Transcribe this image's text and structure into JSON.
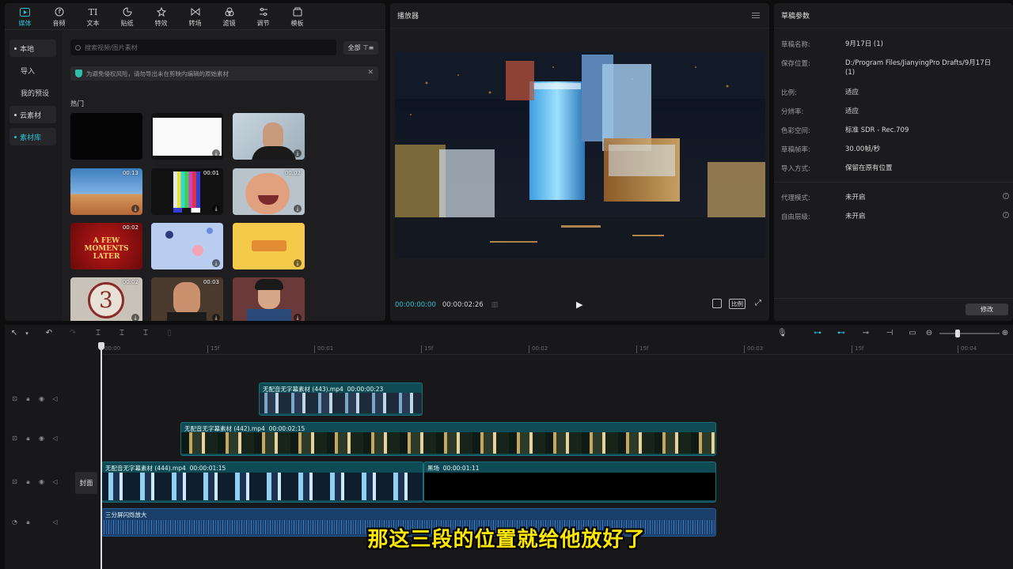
{
  "media_panel": {
    "tabs": [
      {
        "label": "媒体",
        "icon": "media-icon",
        "active": true
      },
      {
        "label": "音频",
        "icon": "audio-icon"
      },
      {
        "label": "文本",
        "icon": "text-icon"
      },
      {
        "label": "贴纸",
        "icon": "sticker-icon"
      },
      {
        "label": "特效",
        "icon": "effects-icon"
      },
      {
        "label": "转场",
        "icon": "transition-icon"
      },
      {
        "label": "滤镜",
        "icon": "filter-icon"
      },
      {
        "label": "调节",
        "icon": "adjust-icon"
      },
      {
        "label": "模板",
        "icon": "template-icon"
      }
    ],
    "sidebar": [
      "本地",
      "导入",
      "我的预设",
      "云素材",
      "素材库"
    ],
    "search_placeholder": "搜索视频/图片素材",
    "filter_label": "全部",
    "notice": "为避免侵权风险，请勿导出未在剪映内编辑的原始素材",
    "section": "热门",
    "thumbs": [
      {
        "duration": "",
        "caption": ""
      },
      {
        "duration": "",
        "caption": ""
      },
      {
        "duration": "",
        "caption": ""
      },
      {
        "duration": "00:13",
        "caption": ""
      },
      {
        "duration": "00:01",
        "caption": ""
      },
      {
        "duration": "00:02",
        "caption": ""
      },
      {
        "duration": "00:02",
        "caption": "A FEW MOMENTS LATER"
      },
      {
        "duration": "",
        "caption": ""
      },
      {
        "duration": "",
        "caption": ""
      },
      {
        "duration": "00:02",
        "caption": ""
      },
      {
        "duration": "00:03",
        "caption": ""
      },
      {
        "duration": "",
        "caption": ""
      }
    ]
  },
  "player": {
    "title": "播放器",
    "current_time": "00:00:00:00",
    "total_time": "00:00:02:26",
    "ratio_label": "比例"
  },
  "props": {
    "title": "草稿参数",
    "rows": [
      {
        "key": "草稿名称:",
        "value": "9月17日 (1)"
      },
      {
        "key": "保存位置:",
        "value": "D:/Program Files/JianyingPro Drafts/9月17日 (1)"
      },
      {
        "key": "比例:",
        "value": "适应"
      },
      {
        "key": "分辨率:",
        "value": "适应"
      },
      {
        "key": "色彩空间:",
        "value": "标准 SDR - Rec.709"
      },
      {
        "key": "草稿帧率:",
        "value": "30.00帧/秒"
      },
      {
        "key": "导入方式:",
        "value": "保留在原有位置"
      },
      {
        "key": "代理模式:",
        "value": "未开启"
      },
      {
        "key": "自由层级:",
        "value": "未开启"
      }
    ],
    "modify_label": "修改"
  },
  "timeline": {
    "ruler": [
      {
        "label": "00:00"
      },
      {
        "label": "15f"
      },
      {
        "label": "00:01"
      },
      {
        "label": "15f"
      },
      {
        "label": "00:02"
      },
      {
        "label": "15f"
      },
      {
        "label": "00:03"
      },
      {
        "label": "15f"
      },
      {
        "label": "00:04"
      }
    ],
    "cover_label": "封面",
    "clips": {
      "c443": {
        "name": "无配音无字幕素材 (443).mp4",
        "duration": "00:00:00:23"
      },
      "c442": {
        "name": "无配音无字幕素材 (442).mp4",
        "duration": "00:00:02:15"
      },
      "c444": {
        "name": "无配音无字幕素材 (444).mp4",
        "duration": "00:00:01:15"
      },
      "black": {
        "name": "黑场",
        "duration": "00:00:01:11"
      },
      "audio": {
        "name": "三分屏闪烁放大"
      }
    }
  },
  "subtitle": "那这三段的位置就给他放好了",
  "colors": {
    "accent": "#29c0d6",
    "clip": "#0f4b55",
    "audio": "#1a3f6a",
    "subtitle": "#ffe800"
  }
}
